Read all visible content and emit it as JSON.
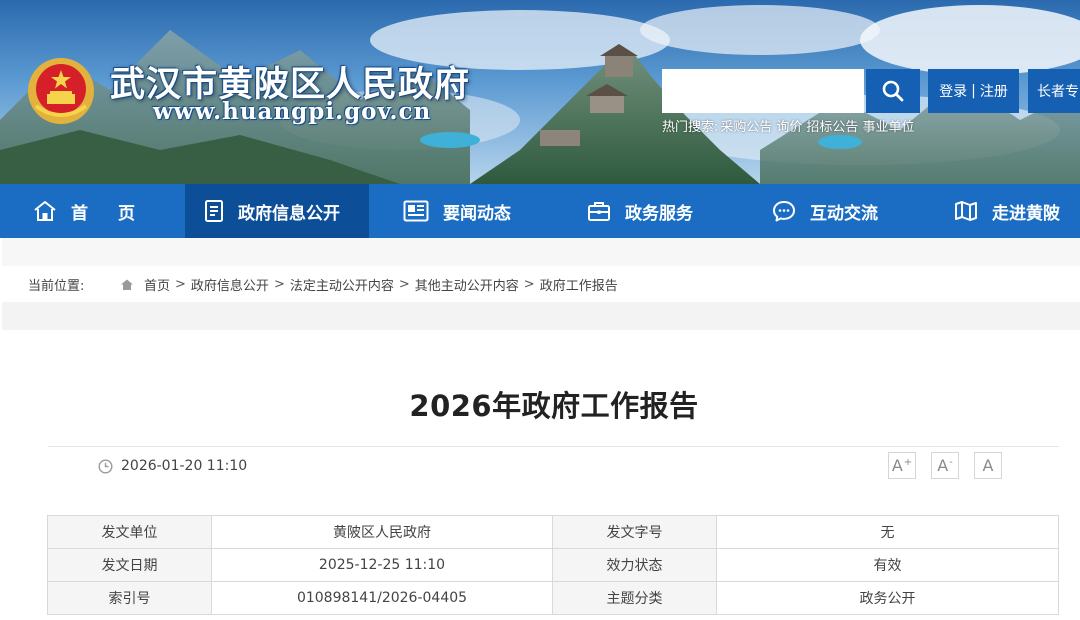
{
  "header": {
    "site_title": "武汉市黄陂区人民政府",
    "site_url": "www.huangpi.gov.cn",
    "search_placeholder": "",
    "hot_search_label": "热门搜索:",
    "hot_search_terms": [
      "采购公告",
      "询价",
      "招标公告",
      "事业单位"
    ],
    "login_label": "登录",
    "login_separator": "|",
    "register_label": "注册",
    "elder_label": "长者专"
  },
  "nav": {
    "items": [
      {
        "label": "首页",
        "icon": "home-icon"
      },
      {
        "label": "政府信息公开",
        "icon": "document-list-icon"
      },
      {
        "label": "要闻动态",
        "icon": "news-icon"
      },
      {
        "label": "政务服务",
        "icon": "briefcase-icon"
      },
      {
        "label": "互动交流",
        "icon": "chat-icon"
      },
      {
        "label": "走进黄陂",
        "icon": "map-icon"
      }
    ],
    "active_index": 1
  },
  "breadcrumb": {
    "label": "当前位置:",
    "items": [
      "首页",
      "政府信息公开",
      "法定主动公开内容",
      "其他主动公开内容",
      "政府工作报告"
    ],
    "separator": ">"
  },
  "article": {
    "title": "2026年政府工作报告",
    "publish_time": "2026-01-20 11:10",
    "font_buttons": [
      {
        "label": "A",
        "sup": "+"
      },
      {
        "label": "A",
        "sup": "-"
      },
      {
        "label": "A",
        "sup": ""
      }
    ]
  },
  "info_table": {
    "rows": [
      [
        "发文单位",
        "黄陂区人民政府",
        "发文字号",
        "无"
      ],
      [
        "发文日期",
        "2025-12-25 11:10",
        "效力状态",
        "有效"
      ],
      [
        "索引号",
        "010898141/2026-04405",
        "主题分类",
        "政务公开"
      ]
    ]
  },
  "colors": {
    "nav_bg": "#1a6dc2",
    "nav_active_bg": "#0c4f98",
    "button_blue": "#1560b3"
  }
}
